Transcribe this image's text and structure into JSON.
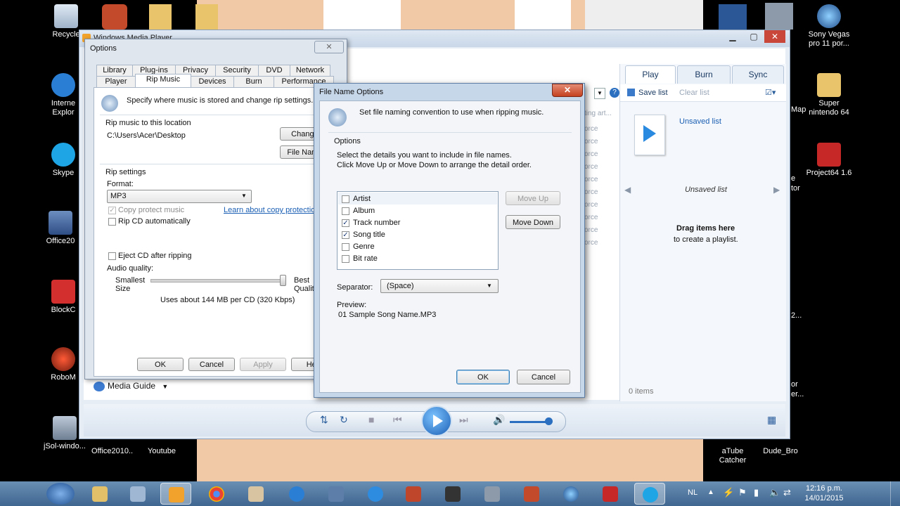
{
  "desktop": {
    "icons_left": [
      {
        "label": "Recycle"
      },
      {
        "label": "Interne Explor"
      },
      {
        "label": "Skype"
      },
      {
        "label": "Office20"
      },
      {
        "label": "BlockC"
      },
      {
        "label": "RoboM"
      },
      {
        "label": "jSol-windo..."
      },
      {
        "label": "Office2010..."
      },
      {
        "label": "Youtube"
      }
    ],
    "icons_right": [
      {
        "label": "Sony Vegas pro 11 por..."
      },
      {
        "label": "Super nintendo 64"
      },
      {
        "label": "Project64 1.6"
      },
      {
        "label": "aTube Catcher"
      },
      {
        "label": "Dude_Bro"
      }
    ],
    "partial_labels": [
      "Map",
      "e",
      "tor",
      "2...",
      "or",
      "er..."
    ]
  },
  "wmp": {
    "title": "Windows Media Player",
    "tabs": [
      "Play",
      "Burn",
      "Sync"
    ],
    "save_list": "Save list",
    "clear_list": "Clear list",
    "unsaved_list_link": "Unsaved list",
    "unsaved_list_title": "Unsaved list",
    "drag_title": "Drag items here",
    "drag_sub": "to create a playlist.",
    "items_count": "0 items",
    "media_guide": "Media Guide",
    "bg_text_rows": [
      "ting art...",
      "orce",
      "orce",
      "orce",
      "orce",
      "orce",
      "orce",
      "orce",
      "orce",
      "orce",
      "orce"
    ]
  },
  "options": {
    "title": "Options",
    "tabs_row1": [
      "Library",
      "Plug-ins",
      "Privacy",
      "Security",
      "DVD",
      "Network"
    ],
    "tabs_row2": [
      "Player",
      "Rip Music",
      "Devices",
      "Burn",
      "Performance"
    ],
    "header_text": "Specify where music is stored and change rip settings.",
    "rip_location_label": "Rip music to this location",
    "rip_path": "C:\\Users\\Acer\\Desktop",
    "change_button": "Change...",
    "file_name_button": "File Name...",
    "rip_settings_label": "Rip settings",
    "format_label": "Format:",
    "format_value": "MP3",
    "copy_protect": "Copy protect music",
    "learn_link": "Learn about copy protection",
    "rip_auto": "Rip CD automatically",
    "eject": "Eject CD after ripping",
    "audio_quality": "Audio quality:",
    "smallest_size": "Smallest Size",
    "best_quality": "Best Quality",
    "usage": "Uses about 144 MB per CD (320 Kbps)",
    "ok": "OK",
    "cancel": "Cancel",
    "apply": "Apply",
    "help": "Help"
  },
  "file_name_options": {
    "title": "File Name Options",
    "close": "✕",
    "header_text": "Set file naming convention to use when ripping music.",
    "options_label": "Options",
    "instructions_1": "Select the details you want to include in file names.",
    "instructions_2": "Click Move Up or Move Down to arrange the detail order.",
    "details": [
      {
        "label": "Artist",
        "checked": false
      },
      {
        "label": "Album",
        "checked": false
      },
      {
        "label": "Track number",
        "checked": true
      },
      {
        "label": "Song title",
        "checked": true
      },
      {
        "label": "Genre",
        "checked": false
      },
      {
        "label": "Bit rate",
        "checked": false
      }
    ],
    "move_up": "Move Up",
    "move_down": "Move Down",
    "separator_label": "Separator:",
    "separator_value": "(Space)",
    "preview_label": "Preview:",
    "preview_value": "01 Sample Song Name.MP3",
    "ok": "OK",
    "cancel": "Cancel"
  },
  "taskbar": {
    "language": "NL",
    "time": "12:16 p.m.",
    "date": "14/01/2015"
  },
  "colors": {
    "link": "#1a5fb4",
    "taskbar": "#4f76a0",
    "desktop_band": "#f0c7a4"
  }
}
